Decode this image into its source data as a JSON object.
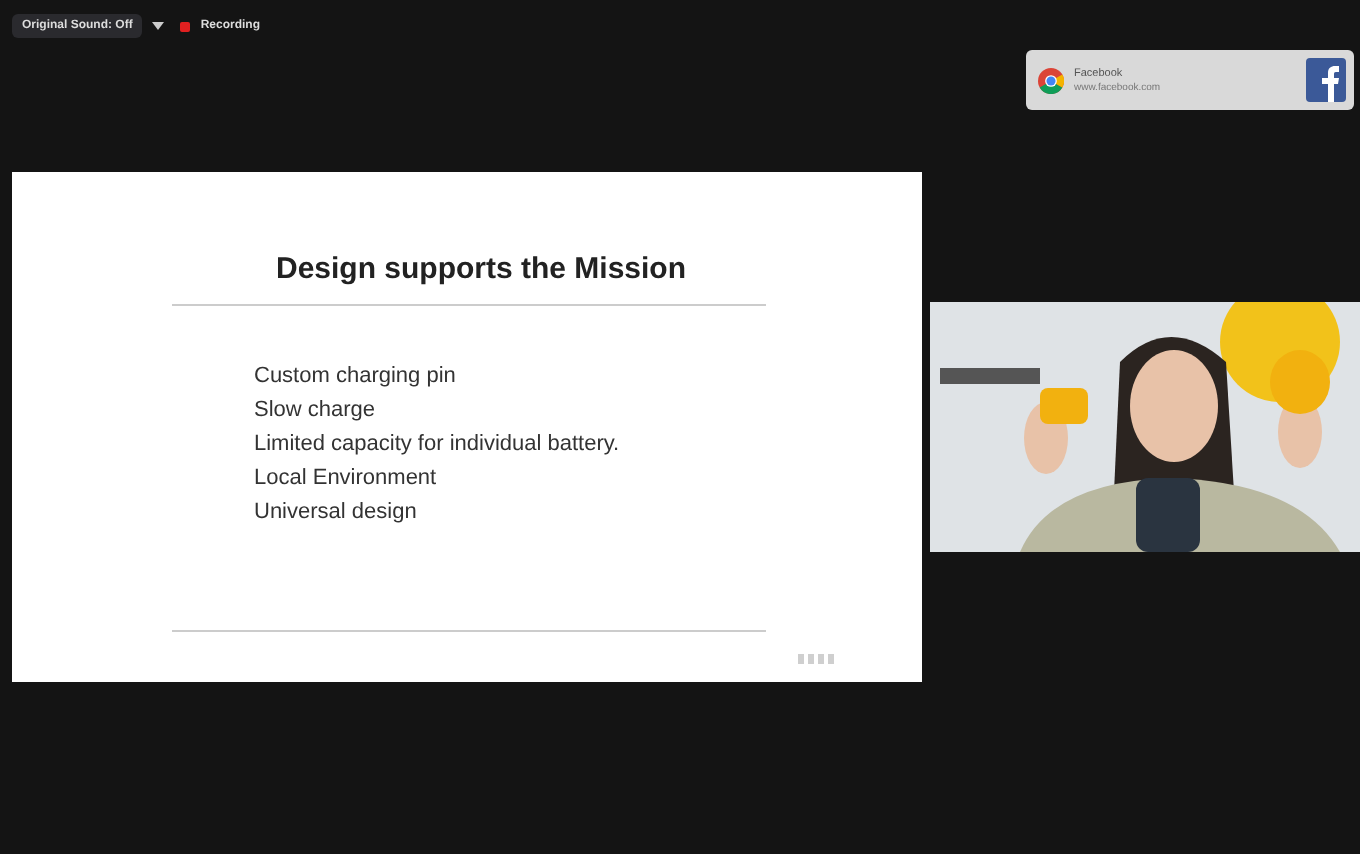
{
  "top_bar": {
    "sound_button": "Original Sound: Off",
    "recording": {
      "label": "Recording",
      "on": true
    }
  },
  "notification": {
    "title": "Facebook",
    "url": "www.facebook.com"
  },
  "slide": {
    "title": "Design supports the Mission",
    "bullets": [
      "Custom charging pin",
      "Slow charge",
      "Limited capacity for individual battery.",
      "Local Environment",
      "Universal design"
    ]
  }
}
